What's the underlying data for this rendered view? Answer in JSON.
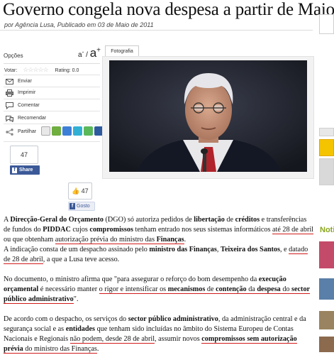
{
  "headline": "Governo congela nova despesa a partir de Maio",
  "byline": "por Agência Lusa, Publicado em 03 de Maio de 2011",
  "sidebar": {
    "options_title": "Opções",
    "font_small": "a",
    "font_small_sup": "-",
    "font_sep": "/",
    "font_big": "a",
    "font_big_sup": "+",
    "vote_label": "Votar:",
    "rating_label": "Rating: 0.0",
    "actions": [
      {
        "label": "Enviar",
        "icon": "envelope-icon"
      },
      {
        "label": "Imprimir",
        "icon": "printer-icon"
      },
      {
        "label": "Comentar",
        "icon": "comment-icon"
      },
      {
        "label": "Recomendar",
        "icon": "recommend-icon"
      },
      {
        "label": "Partilhar",
        "icon": "share-icon"
      }
    ],
    "fb_share_count": "47",
    "fb_share_label": "Share",
    "fb_like_count": "47",
    "fb_like_label": "Gosto"
  },
  "photo_tab": "Fotografia",
  "right_col": {
    "noti_label": "Noti"
  },
  "article": {
    "p1": [
      {
        "t": "A "
      },
      {
        "t": "Direcção-Geral do Orçamento",
        "b": true
      },
      {
        "t": " (DGO) só autoriza pedidos de "
      },
      {
        "t": "libertação",
        "b": true
      },
      {
        "t": " de "
      },
      {
        "t": "créditos",
        "b": true
      },
      {
        "t": " e transferências de fundos do "
      },
      {
        "t": "PIDDAC",
        "b": true
      },
      {
        "t": " cujos "
      },
      {
        "t": "compromissos",
        "b": true
      },
      {
        "t": " tenham entrado nos seus sistemas informáticos "
      },
      {
        "t": "até 28 de abril",
        "u": true
      },
      {
        "t": " ou que obtenham "
      },
      {
        "t": "autorização prévia do ministro das ",
        "u": true
      },
      {
        "t": "Finanças",
        "b": true,
        "u": true
      },
      {
        "t": "."
      }
    ],
    "p1b": [
      {
        "t": "A indicação consta de um despacho assinado pelo "
      },
      {
        "t": "ministro das Finanças",
        "b": true
      },
      {
        "t": ", "
      },
      {
        "t": "Teixeira dos Santos",
        "b": true
      },
      {
        "t": ", e "
      },
      {
        "t": "datado de 28 de abril",
        "u": true
      },
      {
        "t": ", a que a Lusa teve acesso."
      }
    ],
    "p2": [
      {
        "t": "No documento, o ministro afirma que \"para assegurar o reforço do bom desempenho da "
      },
      {
        "t": "execução orçamental",
        "b": true
      },
      {
        "t": " é necessário manter "
      },
      {
        "t": "o rigor e intensificar os ",
        "u": true
      },
      {
        "t": "mecanismos",
        "b": true,
        "u": true
      },
      {
        "t": " de ",
        "u": true
      },
      {
        "t": "contenção",
        "b": true,
        "u": true
      },
      {
        "t": " da ",
        "u": true
      },
      {
        "t": "despesa",
        "b": true,
        "u": true
      },
      {
        "t": " do ",
        "u": true
      },
      {
        "t": "sector público administrativo",
        "b": true,
        "u": true
      },
      {
        "t": "\"."
      }
    ],
    "p3": [
      {
        "t": "De acordo com o despacho, os serviços do "
      },
      {
        "t": "sector público administrativo",
        "b": true
      },
      {
        "t": ", da administração central e da segurança social e as "
      },
      {
        "t": "entidades",
        "b": true
      },
      {
        "t": " que tenham sido incluídas no âmbito do Sistema Europeu de Contas Nacionais e Regionais "
      },
      {
        "t": "não podem, desde 28 de abril",
        "u": true
      },
      {
        "t": ", assumir novos "
      },
      {
        "t": "compromissos sem autorização prévia",
        "b": true,
        "u": true
      },
      {
        "t": " do ministro das Finanças",
        "u": true
      },
      {
        "t": "."
      }
    ]
  }
}
